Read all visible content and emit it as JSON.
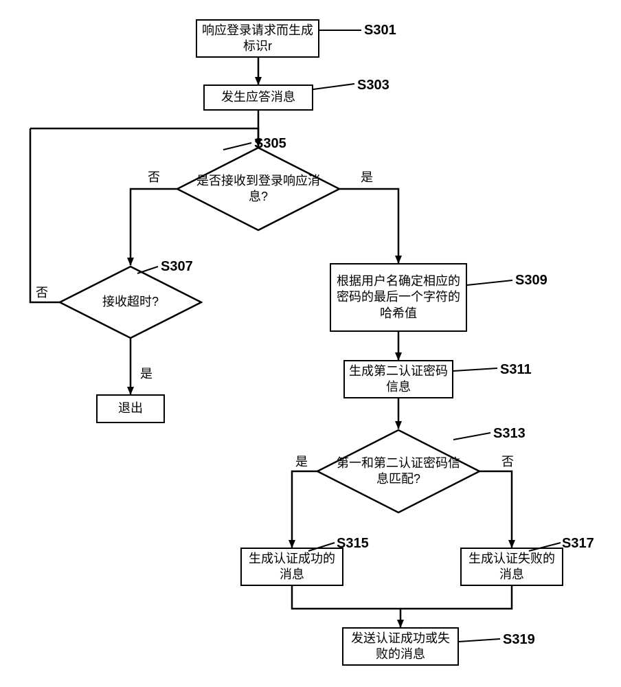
{
  "chart_data": {
    "type": "flowchart",
    "title": "",
    "nodes": [
      {
        "id": "S301",
        "type": "process",
        "text": "响应登录请求而生成标识r"
      },
      {
        "id": "S303",
        "type": "process",
        "text": "发生应答消息"
      },
      {
        "id": "S305",
        "type": "decision",
        "text": "是否接收到登录响应消息?"
      },
      {
        "id": "S307",
        "type": "decision",
        "text": "接收超时?"
      },
      {
        "id": "EXIT",
        "type": "process",
        "text": "退出"
      },
      {
        "id": "S309",
        "type": "process",
        "text": "根据用户名确定相应的密码的最后一个字符的哈希值"
      },
      {
        "id": "S311",
        "type": "process",
        "text": "生成第二认证密码信息"
      },
      {
        "id": "S313",
        "type": "decision",
        "text": "第一和第二认证密码信息匹配?"
      },
      {
        "id": "S315",
        "type": "process",
        "text": "生成认证成功的消息"
      },
      {
        "id": "S317",
        "type": "process",
        "text": "生成认证失败的消息"
      },
      {
        "id": "S319",
        "type": "process",
        "text": "发送认证成功或失败的消息"
      }
    ],
    "edges": [
      {
        "from": "S301",
        "to": "S303",
        "label": ""
      },
      {
        "from": "S303",
        "to": "S305",
        "label": ""
      },
      {
        "from": "S305",
        "to": "S309",
        "label": "是"
      },
      {
        "from": "S305",
        "to": "S307",
        "label": "否"
      },
      {
        "from": "S307",
        "to": "EXIT",
        "label": "是"
      },
      {
        "from": "S307",
        "to": "S305",
        "label": "否"
      },
      {
        "from": "S309",
        "to": "S311",
        "label": ""
      },
      {
        "from": "S311",
        "to": "S313",
        "label": ""
      },
      {
        "from": "S313",
        "to": "S315",
        "label": "是"
      },
      {
        "from": "S313",
        "to": "S317",
        "label": "否"
      },
      {
        "from": "S315",
        "to": "S319",
        "label": ""
      },
      {
        "from": "S317",
        "to": "S319",
        "label": ""
      }
    ]
  },
  "nodes": {
    "s301": {
      "label": "S301",
      "text": "响应登录请求而生成标识r"
    },
    "s303": {
      "label": "S303",
      "text": "发生应答消息"
    },
    "s305": {
      "label": "S305",
      "text": "是否接收到登录响应消息?",
      "yes": "是",
      "no": "否"
    },
    "s307": {
      "label": "S307",
      "text": "接收超时?",
      "yes": "是",
      "no": "否"
    },
    "exit": {
      "text": "退出"
    },
    "s309": {
      "label": "S309",
      "text": "根据用户名确定相应的密码的最后一个字符的哈希值"
    },
    "s311": {
      "label": "S311",
      "text": "生成第二认证密码信息"
    },
    "s313": {
      "label": "S313",
      "text": "第一和第二认证密码信息匹配?",
      "yes": "是",
      "no": "否"
    },
    "s315": {
      "label": "S315",
      "text": "生成认证成功的消息"
    },
    "s317": {
      "label": "S317",
      "text": "生成认证失败的消息"
    },
    "s319": {
      "label": "S319",
      "text": "发送认证成功或失败的消息"
    }
  }
}
